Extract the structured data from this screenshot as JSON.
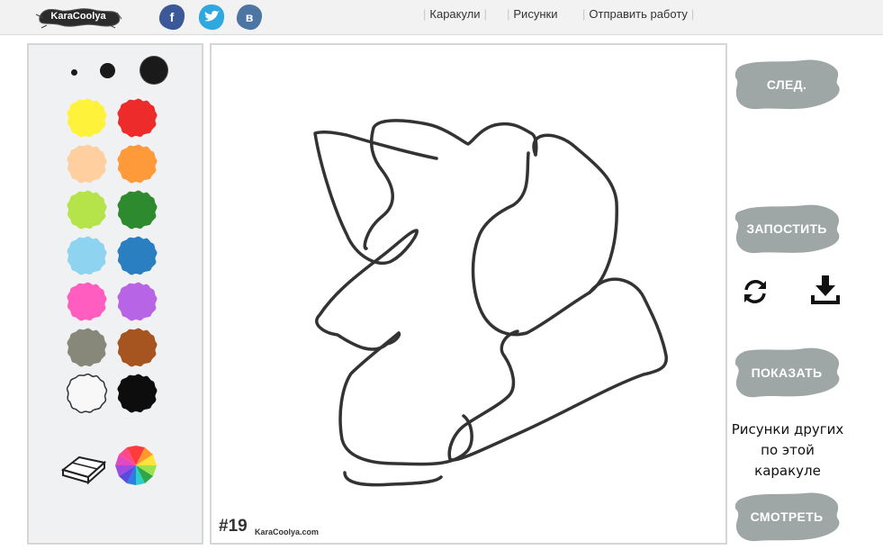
{
  "header": {
    "logo_text": "KaraCoolya",
    "social": [
      {
        "name": "facebook",
        "glyph": "f",
        "color": "#3b5998"
      },
      {
        "name": "twitter",
        "glyph": "t",
        "color": "#2fa8e0"
      },
      {
        "name": "vkontakte",
        "glyph": "в",
        "color": "#4c75a3"
      }
    ],
    "nav": [
      "Каракули",
      "Рисунки",
      "Отправить работу"
    ]
  },
  "palette": {
    "brush_sizes": [
      "small",
      "medium",
      "large"
    ],
    "colors": [
      "#fff23b",
      "#ee2b2b",
      "#ffcfa0",
      "#ff9a3a",
      "#b5e34a",
      "#2e8a2e",
      "#8ed3f0",
      "#2a7fc0",
      "#ff5ec0",
      "#b864e6",
      "#88887a",
      "#a65420",
      "#f8f8f8",
      "#0d0d0d"
    ],
    "tools": [
      "eraser-icon",
      "rainbow-color-picker-icon"
    ]
  },
  "canvas": {
    "number": "#19",
    "site": "KaraCoolya.com"
  },
  "actions": {
    "next_label": "СЛЕД.",
    "post_label": "ЗАПОСТИТЬ",
    "show_label": "ПОКАЗАТЬ",
    "watch_label": "СМОТРЕТЬ",
    "others_line1": "Рисунки других",
    "others_line2": "по этой",
    "others_line3": "каракуле",
    "button_color": "#9ea6a6"
  }
}
